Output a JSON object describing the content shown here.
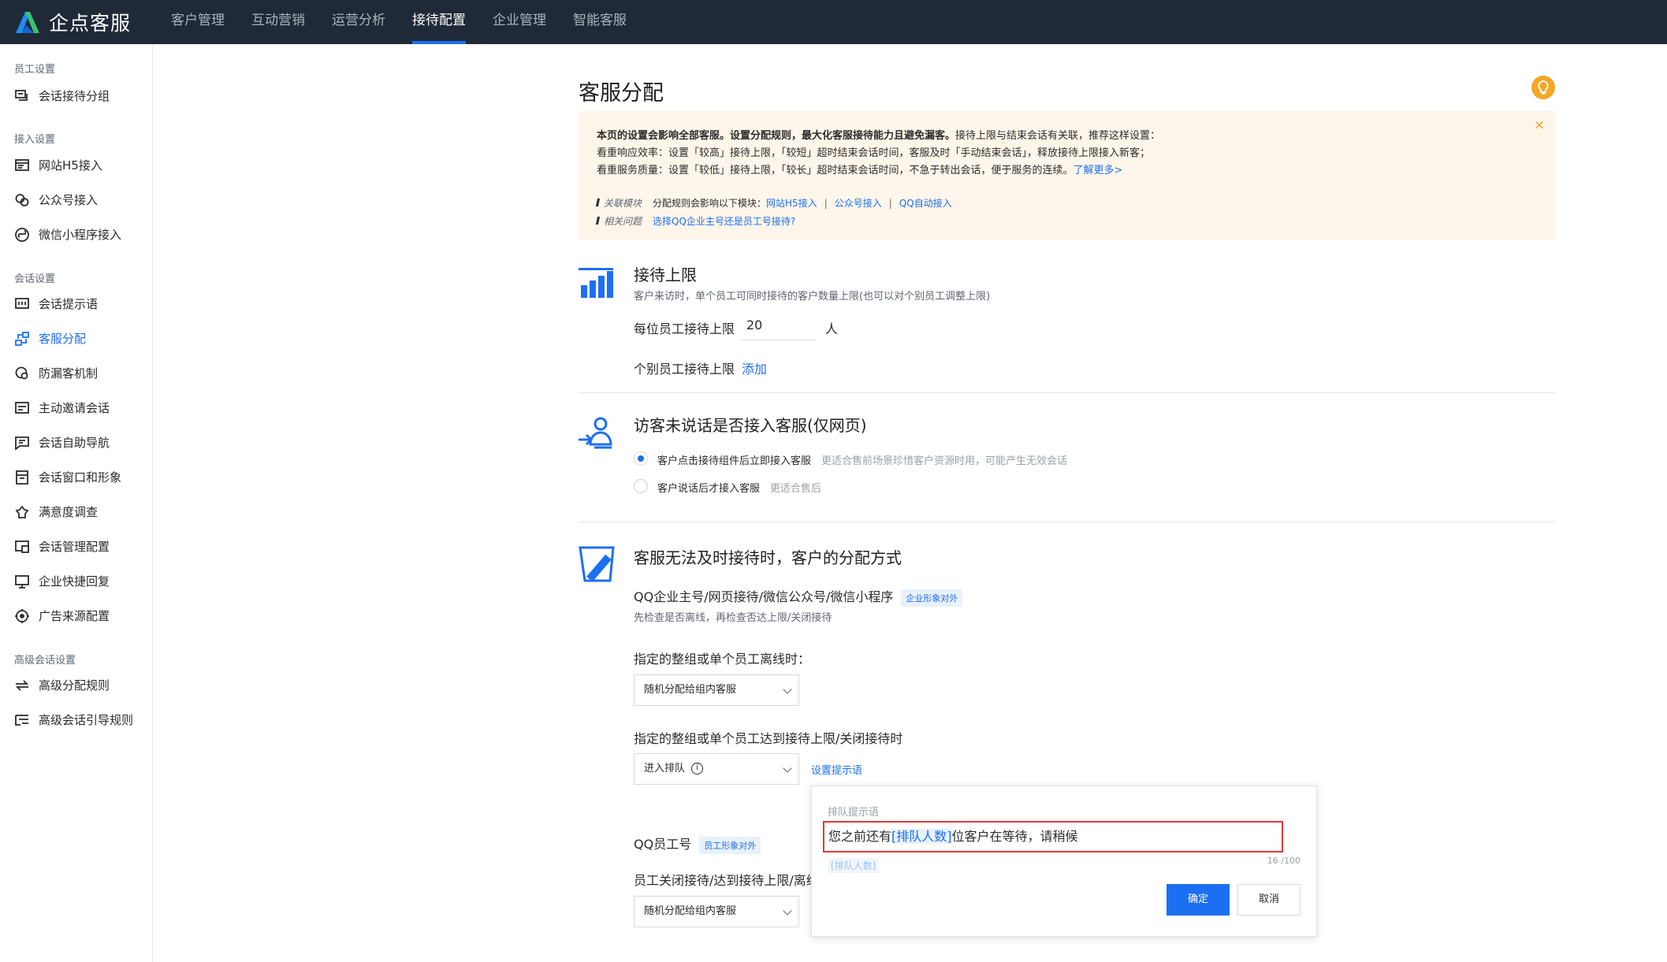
{
  "app": {
    "name": "企点客服"
  },
  "topnav": [
    {
      "label": "客户管理"
    },
    {
      "label": "互动营销"
    },
    {
      "label": "运营分析"
    },
    {
      "label": "接待配置",
      "active": true
    },
    {
      "label": "企业管理"
    },
    {
      "label": "智能客服"
    }
  ],
  "sidebar": {
    "groups": [
      "员工设置",
      "接入设置",
      "会话设置",
      "高级会话设置"
    ],
    "items": [
      {
        "label": "会话接待分组",
        "icon": "chat-group-icon"
      },
      {
        "label": "网站H5接入",
        "icon": "web-icon"
      },
      {
        "label": "公众号接入",
        "icon": "wechat-icon"
      },
      {
        "label": "微信小程序接入",
        "icon": "miniprogram-icon"
      },
      {
        "label": "会话提示语",
        "icon": "prompt-icon"
      },
      {
        "label": "客服分配",
        "icon": "assign-icon",
        "active": true
      },
      {
        "label": "防漏客机制",
        "icon": "anti-loss-icon"
      },
      {
        "label": "主动邀请会话",
        "icon": "invite-icon"
      },
      {
        "label": "会话自助导航",
        "icon": "navigation-icon"
      },
      {
        "label": "会话窗口和形象",
        "icon": "window-icon"
      },
      {
        "label": "满意度调查",
        "icon": "satisfaction-icon"
      },
      {
        "label": "会话管理配置",
        "icon": "manage-icon"
      },
      {
        "label": "企业快捷回复",
        "icon": "quick-reply-icon"
      },
      {
        "label": "广告来源配置",
        "icon": "ad-source-icon"
      },
      {
        "label": "高级分配规则",
        "icon": "advanced-assign-icon"
      },
      {
        "label": "高级会话引导规则",
        "icon": "guide-rule-icon"
      }
    ]
  },
  "page": {
    "title": "客服分配"
  },
  "notice": {
    "line1": "本页的设置会影响全部客服。设置分配规则，最大化客服接待能力且避免漏客。",
    "line1_rest": "接待上限与结束会话有关联，推荐这样设置：",
    "line2": "看重响应效率：设置「较高」接待上限，「较短」超时结束会话时间，客服及时「手动结束会话」，释放接待上限接入新客；",
    "line3": "看重服务质量：设置「较低」接待上限，「较长」超时结束会话时间，不急于转出会话，便于服务的连续。",
    "learn_more": "了解更多>",
    "related_label": "关联模块",
    "related_text": "分配规则会影响以下模块：",
    "related_links": [
      "网站H5接入",
      "公众号接入",
      "QQ自动接入"
    ],
    "question_label": "相关问题",
    "question_link": "选择QQ企业主号还是员工号接待?",
    "close": "×"
  },
  "limit": {
    "title": "接待上限",
    "desc": "客户来访时，单个员工可同时接待的客户数量上限(也可以对个别员工调整上限)",
    "per_label": "每位员工接待上限",
    "per_value": "20",
    "unit": "人",
    "individual_label": "个别员工接待上限",
    "add_link": "添加"
  },
  "silent": {
    "title": "访客未说话是否接入客服(仅网页)",
    "option1": "客户点击接待组件后立即接入客服",
    "option1_hint": "更适合售前场景珍惜客户资源时用，可能产生无效会话",
    "option2": "客户说话后才接入客服",
    "option2_hint": "更适合售后",
    "selected": 1
  },
  "overflow": {
    "title": "客服无法及时接待时，客户的分配方式",
    "qq_main": "QQ企业主号/网页接待/微信公众号/微信小程序",
    "qq_main_badge": "企业形象对外",
    "qq_main_desc": "先检查是否离线，再检查否达上限/关闭接待",
    "offline_label": "指定的整组或单个员工离线时：",
    "offline_value": "随机分配给组内客服",
    "full_label": "指定的整组或单个员工达到接待上限/关闭接待时",
    "full_value": "进入排队",
    "set_prompt_link": "设置提示语",
    "qq_staff": "QQ员工号",
    "qq_staff_badge": "员工形象对外",
    "staff_label": "员工关闭接待/达到接待上限/离线",
    "staff_value": "随机分配给组内客服"
  },
  "popover": {
    "title": "排队提示语",
    "text_before": "您之前还有",
    "variable": "[排队人数]",
    "text_after": "位客户在等待，请稍候",
    "count": "16 /100",
    "var_tag": "[排队人数]",
    "ok": "确定",
    "cancel": "取消"
  }
}
